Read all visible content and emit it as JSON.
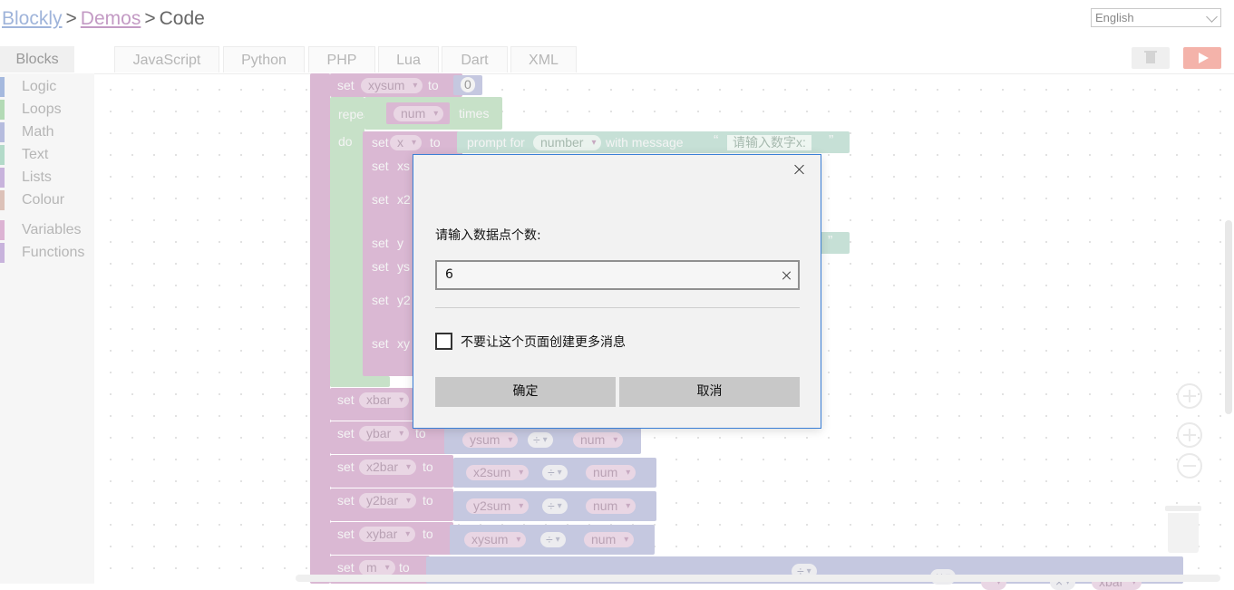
{
  "breadcrumb": {
    "item1": "Blockly",
    "sep1": ">",
    "item2": "Demos",
    "sep2": ">",
    "item3": "Code"
  },
  "language_select": {
    "value": "English"
  },
  "tabs": [
    "Blocks",
    "JavaScript",
    "Python",
    "PHP",
    "Lua",
    "Dart",
    "XML"
  ],
  "toolbox": {
    "categories": [
      {
        "label": "Logic",
        "color": "#a5b9de"
      },
      {
        "label": "Loops",
        "color": "#b3dab5"
      },
      {
        "label": "Math",
        "color": "#b6bcde"
      },
      {
        "label": "Text",
        "color": "#b3dac9"
      },
      {
        "label": "Lists",
        "color": "#c8b3dc"
      },
      {
        "label": "Colour",
        "color": "#dcc1b8"
      },
      {
        "label": "Variables",
        "color": "#dcb3d3"
      },
      {
        "label": "Functions",
        "color": "#c8b3dc"
      }
    ]
  },
  "workspace": {
    "kw_set": "set",
    "kw_to": "to",
    "kw_repeat": "repeat",
    "kw_times": "times",
    "kw_do": "do",
    "kw_prompt": "prompt for",
    "kw_with_message": "with message",
    "var_xysum": "xysum",
    "var_num": "num",
    "var_x": "x",
    "var_number": "number",
    "val_zero": "0",
    "msg_x": "请输入数字x:",
    "partial_xs": "xs",
    "partial_x2": "x2",
    "partial_y": "y",
    "partial_ys": "ys",
    "partial_y2": "y2",
    "partial_xy": "xy",
    "var_xbar": "xbar",
    "var_ybar": "ybar",
    "var_ysum": "ysum",
    "var_x2bar": "x2bar",
    "var_x2sum": "x2sum",
    "var_y2bar": "y2bar",
    "var_y2sum": "y2sum",
    "var_xybar": "xybar",
    "var_m": "m",
    "op_div": "÷",
    "op_mul": "×",
    "quote_open": "“",
    "quote_close": "”"
  },
  "dialog": {
    "message": "请输入数据点个数:",
    "input_value": "6",
    "checkbox_label": "不要让这个页面创建更多消息",
    "ok_label": "确定",
    "cancel_label": "取消",
    "checkbox_checked": false
  },
  "colors": {
    "dialog_border": "#3a7fd6",
    "run_button": "#f4b3aa"
  },
  "icons": [
    "trash-icon",
    "play-icon",
    "close-icon",
    "clear-icon",
    "recenter-icon",
    "zoom-in-icon",
    "zoom-out-icon",
    "chevron-down-icon"
  ]
}
